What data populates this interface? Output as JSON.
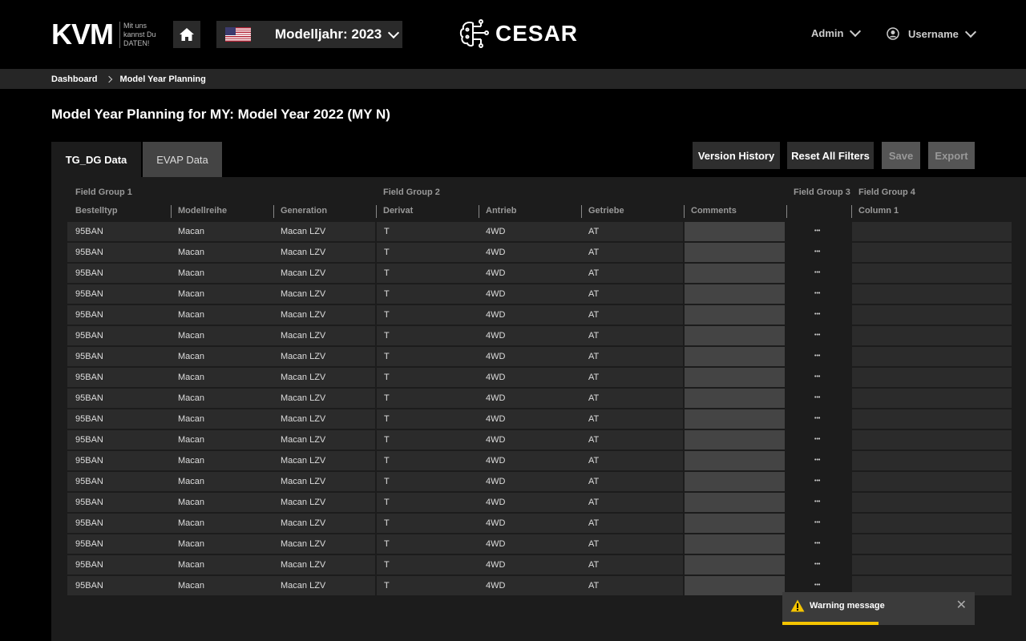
{
  "header": {
    "logo": "KVM",
    "logo_tagline": "Mit uns kannst Du DATEN!",
    "model_year": "Modelljahr: 2023",
    "app_name": "CESAR",
    "admin_label": "Admin",
    "username": "Username"
  },
  "breadcrumb": {
    "items": [
      "Dashboard",
      "Model Year Planning"
    ]
  },
  "page": {
    "title": "Model Year Planning for MY: Model Year 2022 (MY N)"
  },
  "tabs": [
    {
      "label": "TG_DG Data",
      "active": true
    },
    {
      "label": "EVAP Data",
      "active": false
    }
  ],
  "toolbar": {
    "version_history": "Version History",
    "reset_filters": "Reset All Filters",
    "save": "Save",
    "export": "Export"
  },
  "table": {
    "groups": [
      "Field Group 1",
      "Field Group 2",
      "Field Group 3",
      "Field Group 4"
    ],
    "columns": [
      "Bestelltyp",
      "Modellreihe",
      "Generation",
      "Derivat",
      "Antrieb",
      "Getriebe",
      "Comments",
      "Column 1"
    ],
    "row_values": [
      "95BAN",
      "Macan",
      "Macan LZV",
      "T",
      "4WD",
      "AT"
    ],
    "row_count": 18,
    "more_actions": "•••"
  },
  "toast": {
    "message": "Warning message",
    "close": "✕",
    "progress": 0.5,
    "accent_color": "#f5c400"
  }
}
